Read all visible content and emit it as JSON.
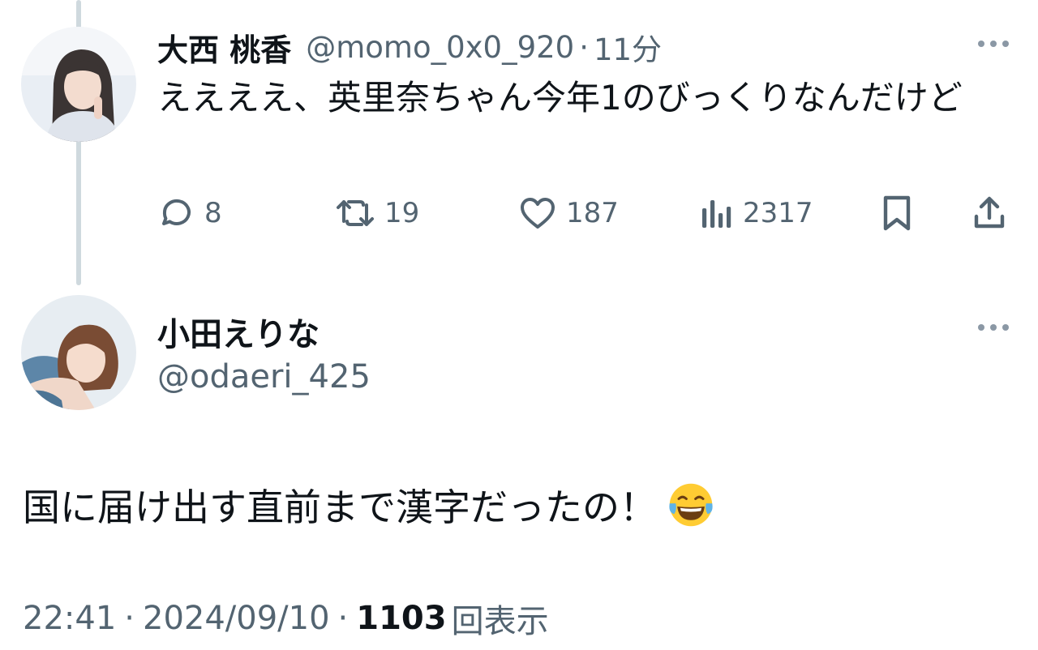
{
  "parent_tweet": {
    "display_name": "大西 桃香",
    "handle": "@momo_0x0_920",
    "separator": "·",
    "time": "11分",
    "text": "ええええ、英里奈ちゃん今年1のびっくりなんだけど",
    "avatar_icon": "user-avatar-photo",
    "actions": {
      "replies": "8",
      "retweets": "19",
      "likes": "187",
      "views": "2317"
    }
  },
  "reply_tweet": {
    "display_name": "小田えりな",
    "handle": "@odaeri_425",
    "text": "国に届け出す直前まで漢字だったの！",
    "emoji_icon": "face-with-tears-of-joy-emoji",
    "avatar_icon": "user-avatar-photo",
    "meta": {
      "time": "22:41",
      "sep1": "·",
      "date": "2024/09/10",
      "sep2": "·",
      "views_count": "1103",
      "views_label": "回表示"
    }
  },
  "colors": {
    "text_primary": "#0f1419",
    "text_secondary": "#536471",
    "thread_line": "#cfd9de"
  }
}
